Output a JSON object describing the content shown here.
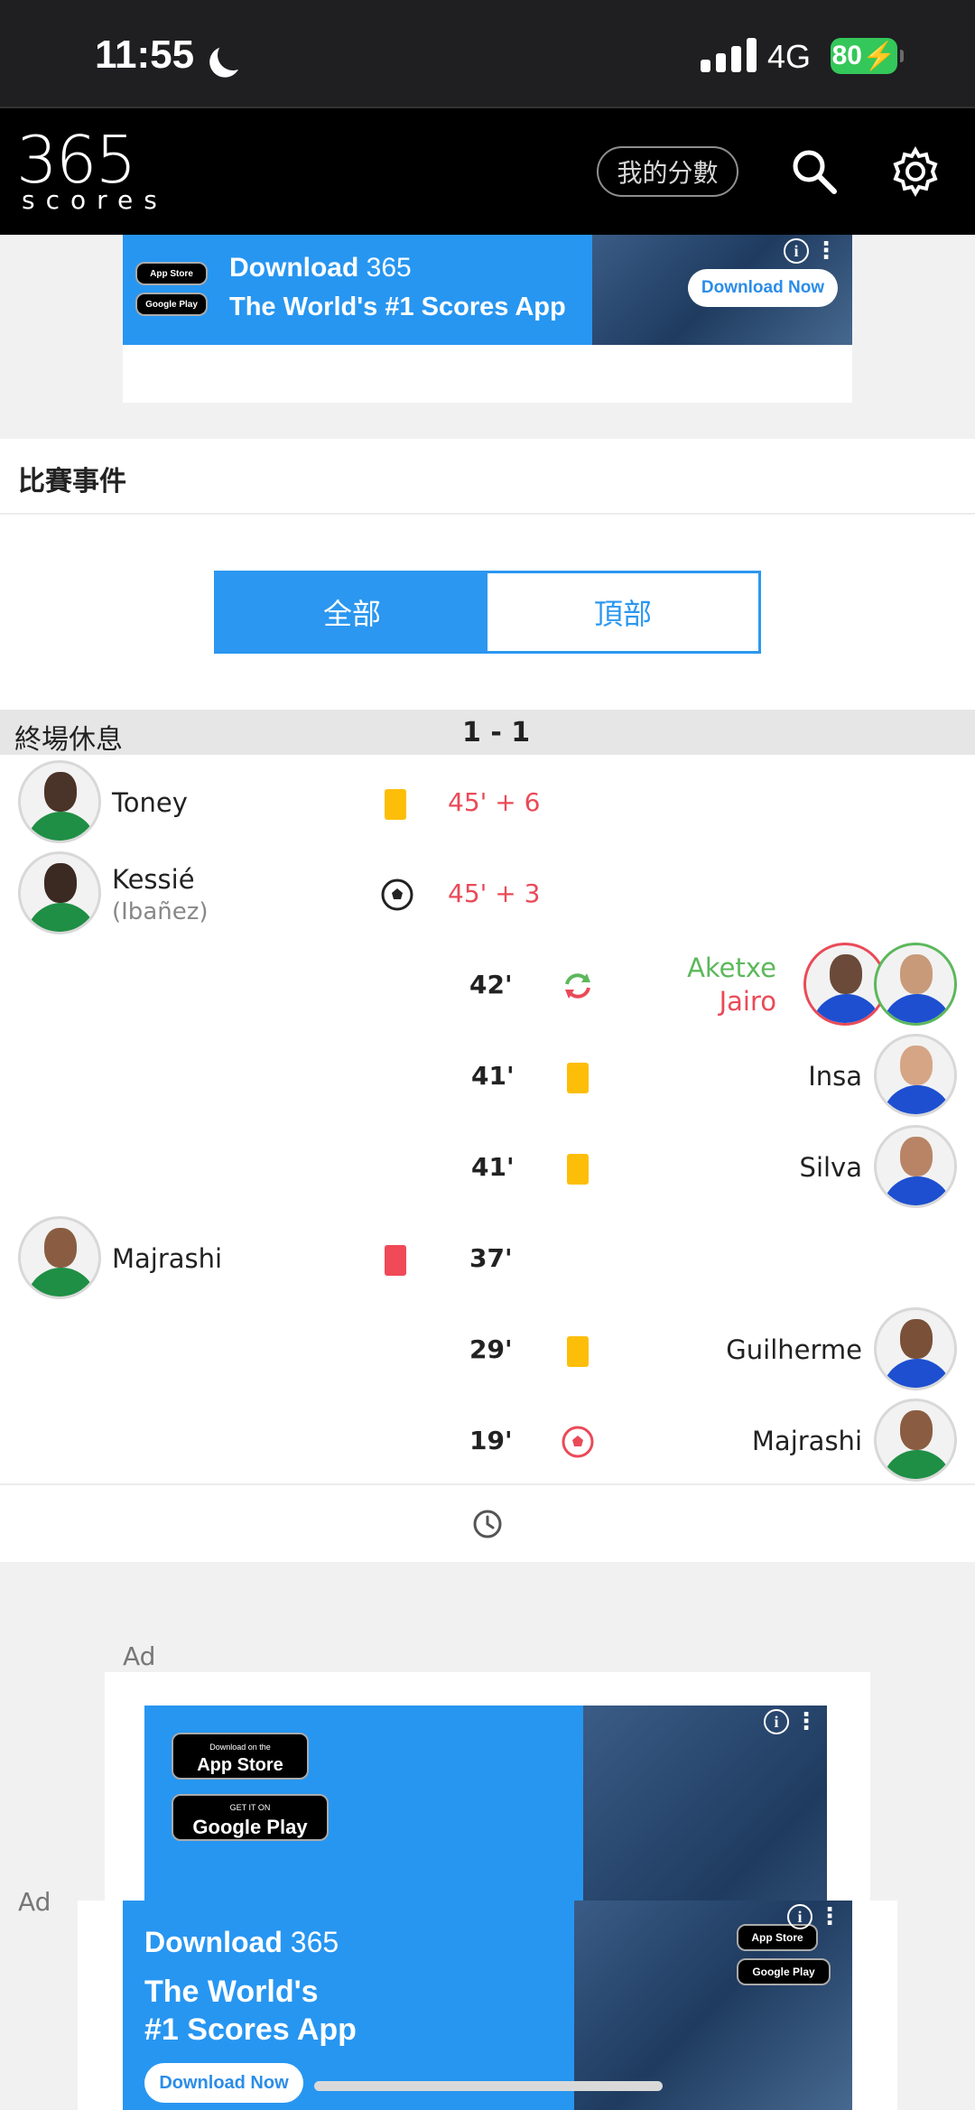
{
  "status_bar": {
    "time": "11:55",
    "network": "4G",
    "battery": "80"
  },
  "header": {
    "logo_number": "365",
    "logo_word": "scores",
    "my_scores_label": "我的分數"
  },
  "top_ad": {
    "download_label": "Download",
    "logo_number": "365",
    "tagline": "The World's #1 Scores App",
    "cta": "Download Now",
    "app_store": "App Store",
    "google_play": "Google Play"
  },
  "events": {
    "title": "比賽事件",
    "tabs": [
      {
        "label": "全部",
        "active": true
      },
      {
        "label": "頂部",
        "active": false
      }
    ],
    "period": {
      "label": "終場休息",
      "score": "1 - 1"
    },
    "items": [
      {
        "side": "home",
        "player": "Toney",
        "sub": "",
        "icon": "yellow-card",
        "minute": "45' + 6"
      },
      {
        "side": "home",
        "player": "Kessié",
        "sub": "(Ibañez)",
        "icon": "goal-ball",
        "minute": "45' + 3"
      },
      {
        "side": "away",
        "player_in": "Aketxe",
        "player_out": "Jairo",
        "icon": "substitution",
        "minute": "42'"
      },
      {
        "side": "away",
        "player": "Insa",
        "icon": "yellow-card",
        "minute": "41'"
      },
      {
        "side": "away",
        "player": "Silva",
        "icon": "yellow-card",
        "minute": "41'"
      },
      {
        "side": "home",
        "player": "Majrashi",
        "sub": "",
        "icon": "red-card",
        "minute": "37'"
      },
      {
        "side": "away",
        "player": "Guilherme",
        "icon": "yellow-card",
        "minute": "29'"
      },
      {
        "side": "away",
        "player": "Majrashi",
        "icon": "own-goal",
        "minute": "19'"
      }
    ]
  },
  "bottom_ads": {
    "ad_label": "Ad",
    "ad1": {
      "app_store_small": "Download on the",
      "app_store": "App Store",
      "google_play_small": "GET IT ON",
      "google_play": "Google Play"
    },
    "ad2": {
      "download_label": "Download",
      "logo_number": "365",
      "tagline_line1": "The World's",
      "tagline_line2": "#1 Scores App",
      "cta": "Download Now",
      "app_store": "App Store",
      "google_play": "Google Play"
    }
  },
  "colors": {
    "accent_blue": "#2b97f0",
    "minute_red": "#ea4a58",
    "sub_in_green": "#5cb85c",
    "sub_out_red": "#ea4a58",
    "yellow_card": "#fdbe0a",
    "red_card": "#f04957"
  }
}
